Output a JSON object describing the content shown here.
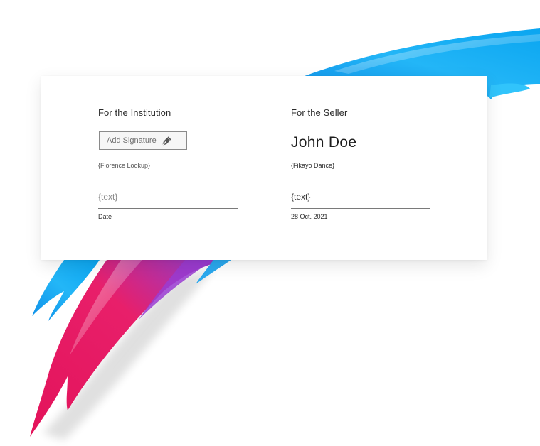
{
  "institution": {
    "heading": "For the Institution",
    "add_signature_label": "Add Signature",
    "name_placeholder": "{Florence  Lookup}",
    "text_placeholder": "{text}",
    "date_caption": "Date"
  },
  "seller": {
    "heading": "For the Seller",
    "signature_name": "John Doe",
    "name_placeholder": "{Fikayo Dance}",
    "text_placeholder": "{text}",
    "date_value": "28 Oct. 2021"
  },
  "colors": {
    "brush_blue": "#1fb4f5",
    "brush_pink": "#e5175f",
    "brush_purple": "#7a3fd0"
  }
}
